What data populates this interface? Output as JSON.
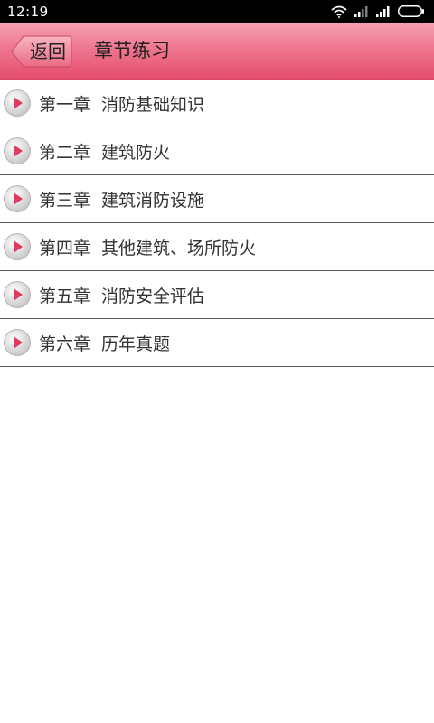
{
  "status_bar": {
    "time": "12:19",
    "icons": [
      "wifi-icon",
      "signal-icon",
      "signal-icon",
      "battery-icon"
    ]
  },
  "header": {
    "back_label": "返回",
    "title": "章节练习"
  },
  "colors": {
    "header_top": "#f7a2b3",
    "header_bottom": "#e64f6d",
    "play_arrow": "#e23a5e",
    "divider": "#555555"
  },
  "chapters": [
    {
      "num": "第一章",
      "title": "消防基础知识",
      "icon": "play-icon"
    },
    {
      "num": "第二章",
      "title": "建筑防火",
      "icon": "play-icon"
    },
    {
      "num": "第三章",
      "title": "建筑消防设施",
      "icon": "play-icon"
    },
    {
      "num": "第四章",
      "title": "其他建筑、场所防火",
      "icon": "play-icon"
    },
    {
      "num": "第五章",
      "title": "消防安全评估",
      "icon": "play-icon"
    },
    {
      "num": "第六章",
      "title": "历年真题",
      "icon": "play-icon"
    }
  ]
}
